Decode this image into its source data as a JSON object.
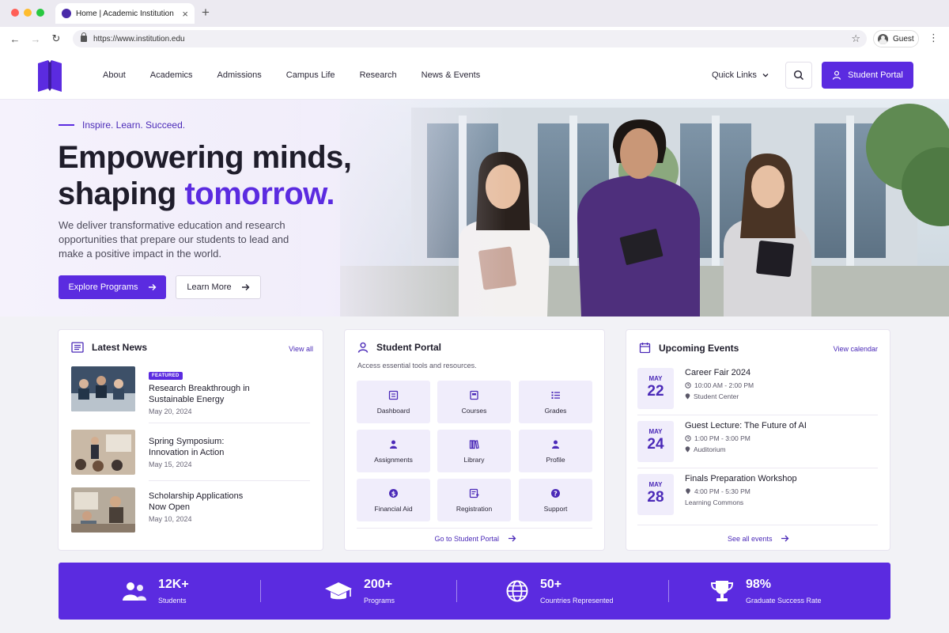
{
  "browser": {
    "tab_title": "Home | Academic Institution",
    "tab_close": "×",
    "new_tab": "+",
    "url": "https://www.institution.edu",
    "profile_name": "Guest",
    "back": "←",
    "forward": "→",
    "reload": "↻",
    "star": "☆",
    "menu": "⋮"
  },
  "header": {
    "nav": [
      "About",
      "Academics",
      "Admissions",
      "Campus Life",
      "Research",
      "News & Events"
    ],
    "quick_links": "Quick Links",
    "portal_button": "Student Portal"
  },
  "hero": {
    "eyebrow": "Inspire. Learn. Succeed.",
    "headline_line1": "Empowering minds,",
    "headline_line2_plain": "shaping ",
    "headline_line2_accent": "tomorrow.",
    "subcopy": "We deliver transformative education and research opportunities that prepare our students to lead and make a positive impact in the world.",
    "primary_button": "Explore Programs",
    "secondary_button": "Learn More"
  },
  "news": {
    "title": "Latest News",
    "view_all": "View all",
    "items": [
      {
        "badge": "FEATURED",
        "headline": "Research Breakthrough in Sustainable Energy",
        "date": "May 20, 2024"
      },
      {
        "badge": "",
        "headline": "Spring Symposium: Innovation in Action",
        "date": "May 15, 2024"
      },
      {
        "badge": "",
        "headline": "Scholarship Applications Now Open",
        "date": "May 10, 2024"
      }
    ]
  },
  "portal": {
    "title": "Student Portal",
    "subtitle": "Access essential tools and resources.",
    "tiles": [
      {
        "label": "Dashboard",
        "icon": "dashboard-icon"
      },
      {
        "label": "Courses",
        "icon": "courses-icon"
      },
      {
        "label": "Grades",
        "icon": "grades-icon"
      },
      {
        "label": "Assignments",
        "icon": "assignments-icon"
      },
      {
        "label": "Library",
        "icon": "library-icon"
      },
      {
        "label": "Profile",
        "icon": "profile-icon"
      },
      {
        "label": "Financial Aid",
        "icon": "financial-aid-icon"
      },
      {
        "label": "Registration",
        "icon": "registration-icon"
      },
      {
        "label": "Support",
        "icon": "support-icon"
      }
    ],
    "go_link": "Go to Student Portal"
  },
  "events": {
    "title": "Upcoming Events",
    "view_calendar": "View calendar",
    "items": [
      {
        "month": "MAY",
        "day": "22",
        "title": "Career Fair 2024",
        "time": "10:00 AM - 2:00 PM",
        "location": "Student Center"
      },
      {
        "month": "MAY",
        "day": "24",
        "title": "Guest Lecture: The Future of AI",
        "time": "1:00 PM - 3:00 PM",
        "location": "Auditorium"
      },
      {
        "month": "MAY",
        "day": "28",
        "title": "Finals Preparation Workshop",
        "time": "4:00 PM - 5:30 PM",
        "location": "Learning Commons"
      }
    ],
    "see_all": "See all events"
  },
  "stats": [
    {
      "value": "12K+",
      "label": "Students",
      "icon": "students-icon"
    },
    {
      "value": "200+",
      "label": "Programs",
      "icon": "graduation-cap-icon"
    },
    {
      "value": "50+",
      "label": "Countries Represented",
      "icon": "globe-icon"
    },
    {
      "value": "98%",
      "label": "Graduate Success Rate",
      "icon": "trophy-icon"
    }
  ],
  "colors": {
    "brand_purple": "#5b2be0",
    "brand_purple_dark": "#4b2ab8",
    "tile_background": "#f0edfb"
  }
}
